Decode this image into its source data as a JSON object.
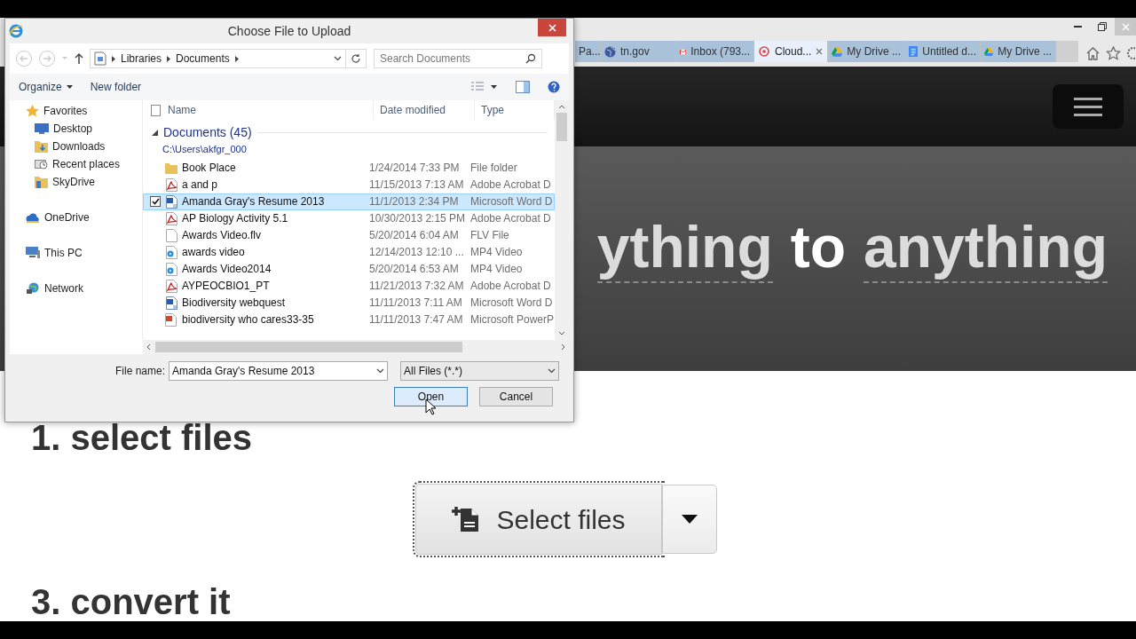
{
  "browser": {
    "tabs": [
      {
        "label": "Pa...",
        "selected": false
      },
      {
        "label": "tn.gov",
        "selected": false
      },
      {
        "label": "Inbox (793...",
        "selected": false
      },
      {
        "label": "Cloud...",
        "selected": true
      },
      {
        "label": "My Drive ...",
        "selected": false
      },
      {
        "label": "Untitled d...",
        "selected": false
      },
      {
        "label": "My Drive ...",
        "selected": false
      }
    ]
  },
  "page": {
    "hero": [
      {
        "text": "ything",
        "kind": "muted"
      },
      {
        "text": "to",
        "kind": "strong"
      },
      {
        "text": "anything",
        "kind": "muted"
      }
    ],
    "steps": [
      "1. select files",
      "3. convert it"
    ],
    "select_button": {
      "label": "Select files",
      "focused": true
    }
  },
  "dialog": {
    "title": "Choose File to Upload",
    "breadcrumb": [
      "Libraries",
      "Documents"
    ],
    "search": {
      "placeholder": "Search Documents"
    },
    "toolbar": [
      "Organize",
      "New folder"
    ],
    "nav": [
      {
        "label": "Favorites",
        "children": [
          {
            "label": "Desktop"
          },
          {
            "label": "Downloads"
          },
          {
            "label": "Recent places"
          },
          {
            "label": "SkyDrive"
          }
        ]
      },
      {
        "label": "OneDrive"
      },
      {
        "label": "This PC"
      },
      {
        "label": "Network"
      }
    ],
    "select_all": {
      "checked": false
    },
    "columns": [
      "Name",
      "Date modified",
      "Type"
    ],
    "group": {
      "title": "Documents (45)",
      "path": "C:\\Users\\akfgr_000"
    },
    "files": [
      {
        "name": "Book Place",
        "date": "1/24/2014 7:33 PM",
        "type": "File folder",
        "kind": "folder",
        "selected": false
      },
      {
        "name": "a and p",
        "date": "11/15/2013 7:13 AM",
        "type": "Adobe Acrobat D",
        "kind": "pdf",
        "selected": false
      },
      {
        "name": "Amanda Gray's Resume 2013",
        "date": "11/1/2013 2:34 PM",
        "type": "Microsoft Word D",
        "kind": "word",
        "selected": true
      },
      {
        "name": "AP Biology Activity 5.1",
        "date": "10/30/2013 2:15 PM",
        "type": "Adobe Acrobat D",
        "kind": "pdf",
        "selected": false
      },
      {
        "name": "Awards Video.flv",
        "date": "5/20/2014 6:04 AM",
        "type": "FLV File",
        "kind": "blank",
        "selected": false
      },
      {
        "name": "awards video",
        "date": "12/14/2013 12:10 ...",
        "type": "MP4 Video",
        "kind": "video",
        "selected": false
      },
      {
        "name": "Awards Video2014",
        "date": "5/20/2014 6:53 AM",
        "type": "MP4 Video",
        "kind": "video",
        "selected": false
      },
      {
        "name": "AYPEOCBIO1_PT",
        "date": "11/21/2013 7:32 AM",
        "type": "Adobe Acrobat D",
        "kind": "pdf",
        "selected": false
      },
      {
        "name": "Biodiversity webquest",
        "date": "11/11/2013 7:11 AM",
        "type": "Microsoft Word D",
        "kind": "word",
        "selected": false
      },
      {
        "name": "biodiversity who cares33-35",
        "date": "11/11/2013 7:47 AM",
        "type": "Microsoft PowerP",
        "kind": "ppt",
        "selected": false
      }
    ],
    "file_name_label": "File name:",
    "file_name": "Amanda Gray's Resume 2013",
    "filter": "All Files (*.*)",
    "buttons": [
      {
        "label": "Open",
        "kind": "default"
      },
      {
        "label": "Cancel",
        "kind": "normal"
      }
    ]
  }
}
